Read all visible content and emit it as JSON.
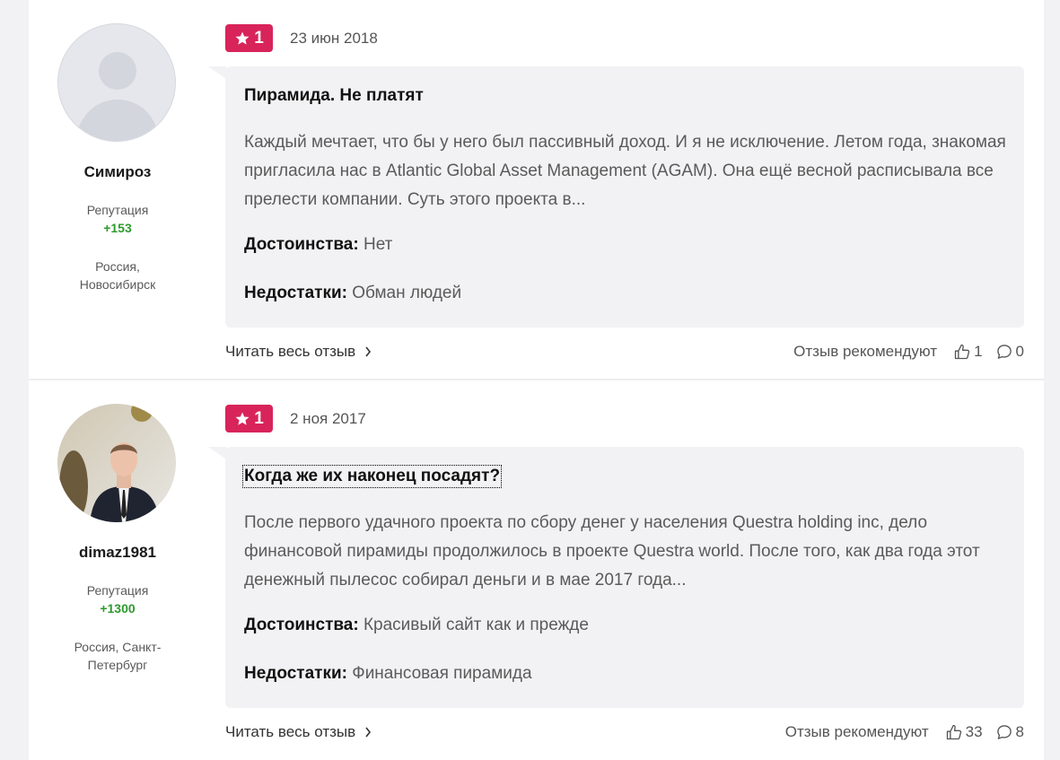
{
  "reviews": [
    {
      "author": {
        "name": "Симироз",
        "reputation_label": "Репутация",
        "reputation": "+153",
        "location": "Россия, Новосибирск",
        "avatar": "default-user-avatar"
      },
      "rating": "1",
      "date": "23 июн 2018",
      "title": "Пирамида. Не платят",
      "text": "Каждый мечтает, что бы у него был пассивный доход. И я не исключение. Летом года, знакомая пригласила нас в Atlantic Global Asset Management (AGAM). Она ещё весной расписывала все прелести компании. Суть этого проекта в...",
      "pros_label": "Достоинства:",
      "pros": "Нет",
      "cons_label": "Недостатки:",
      "cons": "Обман людей",
      "read_more": "Читать весь отзыв",
      "recommend_label": "Отзыв рекомендуют",
      "likes": "1",
      "comments": "0"
    },
    {
      "author": {
        "name": "dimaz1981",
        "reputation_label": "Репутация",
        "reputation": "+1300",
        "location": "Россия, Санкт-Петербург",
        "avatar": "user-photo"
      },
      "rating": "1",
      "date": "2 ноя 2017",
      "title": "Когда же их наконец посадят?",
      "text": "После первого удачного проекта по сбору денег у населения Questra holding inc, дело финансовой пирамиды продолжилось в проекте Questra world. После того, как два года этот денежный пылесос собирал деньги и в мае 2017 года...",
      "pros_label": "Достоинства:",
      "pros": "Красивый сайт как и прежде",
      "cons_label": "Недостатки:",
      "cons": "Финансовая пирамида",
      "read_more": "Читать весь отзыв",
      "recommend_label": "Отзыв рекомендуют",
      "likes": "33",
      "comments": "8"
    }
  ],
  "colors": {
    "rating_badge": "#d8245a",
    "reputation": "#2e9a2e",
    "bubble": "#f2f2f4"
  }
}
